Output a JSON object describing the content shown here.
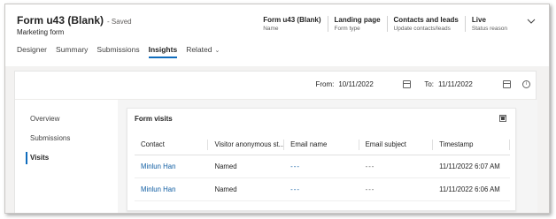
{
  "header": {
    "title": "Form u43 (Blank)",
    "saved_status": "- Saved",
    "subtitle": "Marketing form",
    "summary": [
      {
        "value": "Form u43 (Blank)",
        "label": "Name"
      },
      {
        "value": "Landing page",
        "label": "Form type"
      },
      {
        "value": "Contacts and leads",
        "label": "Update contacts/leads"
      },
      {
        "value": "Live",
        "label": "Status reason"
      }
    ]
  },
  "tabs": [
    {
      "label": "Designer"
    },
    {
      "label": "Summary"
    },
    {
      "label": "Submissions"
    },
    {
      "label": "Insights",
      "active": true
    },
    {
      "label": "Related"
    }
  ],
  "date_filter": {
    "from_label": "From:",
    "from_value": "10/11/2022",
    "to_label": "To:",
    "to_value": "11/11/2022"
  },
  "sidenav": [
    {
      "label": "Overview"
    },
    {
      "label": "Submissions"
    },
    {
      "label": "Visits",
      "active": true
    }
  ],
  "visits": {
    "title": "Form visits",
    "columns": [
      "Contact",
      "Visitor anonymous st...",
      "Email name",
      "Email subject",
      "Timestamp"
    ],
    "rows": [
      {
        "contact": "Minlun Han",
        "visitor_status": "Named",
        "email_name": "---",
        "email_subject": "---",
        "timestamp": "11/11/2022 6:07 AM"
      },
      {
        "contact": "Minlun Han",
        "visitor_status": "Named",
        "email_name": "---",
        "email_subject": "---",
        "timestamp": "11/11/2022 6:06 AM"
      }
    ]
  },
  "colors": {
    "accent": "#0f6cbd",
    "link": "#115ea3",
    "background": "#f3f2f1"
  },
  "icons": {
    "calendar": "calendar-icon",
    "info": "info-icon",
    "export": "export-to-excel-icon",
    "collapse": "chevron-down-icon"
  }
}
